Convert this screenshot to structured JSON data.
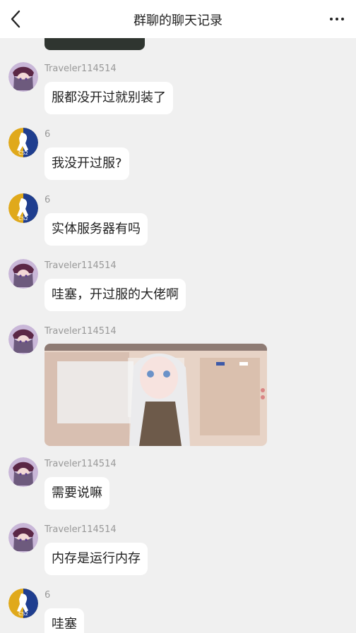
{
  "header": {
    "title": "群聊的聊天记录",
    "back_icon": "chevron-left-icon",
    "more_icon": "more-horizontal-icon"
  },
  "messages": [
    {
      "sender": "Traveler114514",
      "text": "服都没开过就别装了"
    },
    {
      "sender": "6",
      "text": "我没开过服?"
    },
    {
      "sender": "6",
      "text": "实体服务器有吗"
    },
    {
      "sender": "Traveler114514",
      "text": "哇塞，开过服的大佬啊"
    },
    {
      "sender": "Traveler114514",
      "image": "screenshot-image"
    },
    {
      "sender": "Traveler114514",
      "text": "需要说嘛"
    },
    {
      "sender": "Traveler114514",
      "text": "内存是运行内存"
    },
    {
      "sender": "6",
      "text": "哇塞"
    }
  ],
  "colors": {
    "background": "#f0f0f0",
    "bubble": "#ffffff",
    "name": "#999999",
    "text": "#222222"
  }
}
